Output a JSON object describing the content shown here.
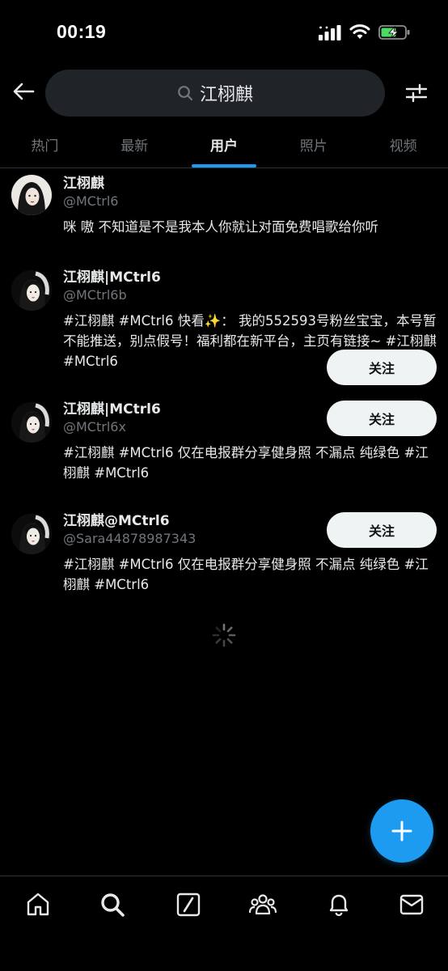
{
  "status_bar": {
    "time": "00:19"
  },
  "search": {
    "query": "江栩麒"
  },
  "tabs": [
    {
      "label": "热门",
      "active": false
    },
    {
      "label": "最新",
      "active": false
    },
    {
      "label": "用户",
      "active": true
    },
    {
      "label": "照片",
      "active": false
    },
    {
      "label": "视频",
      "active": false
    }
  ],
  "users": [
    {
      "name": "江栩麒",
      "handle": "@MCtrl6",
      "bio": "咪 嗷 不知道是不是我本人你就让对面免费唱歌给你听",
      "follow_label": ""
    },
    {
      "name": "江栩麒|MCtrl6",
      "handle": "@MCtrl6b",
      "bio": "#江栩麒 #MCtrl6 快看✨： 我的552593号粉丝宝宝，本号暂不能推送，别点假号！福利都在新平台，主页有链接~ #江栩麒 #MCtrl6",
      "follow_label": "关注"
    },
    {
      "name": "江栩麒|MCtrl6",
      "handle": "@MCtrl6x",
      "bio": "#江栩麒 #MCtrl6 仅在电报群分享健身照 不漏点 纯绿色 #江栩麒 #MCtrl6",
      "follow_label": "关注"
    },
    {
      "name": "江栩麒@MCtrl6",
      "handle": "@Sara44878987343",
      "bio": "#江栩麒 #MCtrl6 仅在电报群分享健身照 不漏点 纯绿色 #江栩麒 #MCtrl6",
      "follow_label": "关注"
    }
  ],
  "icons": {
    "back": "arrow-left-icon",
    "search": "search-icon",
    "filter": "sliders-icon",
    "fab": "plus-icon",
    "nav": [
      "home-icon",
      "search-icon",
      "grok-icon",
      "communities-icon",
      "bell-icon",
      "mail-icon"
    ]
  },
  "colors": {
    "accent": "#1d9bf0",
    "background": "#000000",
    "muted": "#71767b"
  }
}
